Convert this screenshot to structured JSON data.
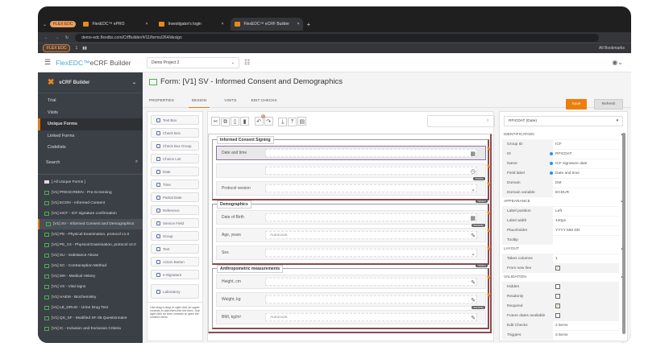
{
  "browser": {
    "profile_badge": "FLEX EDC",
    "tabs": [
      {
        "label": "FlexEDC™ ePRO"
      },
      {
        "label": "Investigator's login"
      },
      {
        "label": "FlexEDC™ eCRF Builder"
      }
    ],
    "url": "demo-edc.flexdbs.com/CrfBuilder/#/11/forms/264/design",
    "bookmark_badge": "FLEX EDC",
    "bookmark_count": "1",
    "all_bookmarks": "All Bookmarks"
  },
  "header": {
    "brand_prefix": "FlexEDC™",
    "brand_suffix": "eCRF Builder",
    "project": "Demo Project 2"
  },
  "sidebar": {
    "title": "eCRF Builder",
    "nav": [
      "Trial",
      "Visits",
      "Unique Forms",
      "Linked Forms",
      "Codelists"
    ],
    "search": "Search",
    "all_forms": "[ All Unique Forms ]",
    "forms": [
      "[V1] PRESCREEN - Pre-Screening",
      "[V1] ECON - Informed Consent",
      "[V1] eICF - ICF signature confirmation",
      "[V1] SV - Informed Consent and Demographics",
      "[V1] PE - Physical Examination, protocol v1.0",
      "[V1] PE_V2 - Physical Examination, protocol v2.0",
      "[V1] SU - Substance Abuse",
      "[V1] SC - Contraception Method",
      "[V1] MH - Medical History",
      "[V1] VS - Vital signs",
      "[V1] HAEM - Biochemistry",
      "[V1] LB_DRUG - Urine Drug Test",
      "[V1] QS_SF - Modified SF-36 Questionnaire",
      "[V1] IC - Inclusion and Exclusion Criteria"
    ]
  },
  "page": {
    "title": "Form: [V1] SV - Informed Consent and Demographics",
    "tabs": [
      "PROPERTIES",
      "DESIGN",
      "VISITS",
      "EDIT CHECKS"
    ],
    "save": "Save",
    "refresh": "Refresh",
    "undo_count": "0"
  },
  "toolbox": {
    "items": [
      "Text Box",
      "Check Box",
      "Check Box Group",
      "Choice List",
      "Date",
      "Time",
      "Partial Date",
      "Reference",
      "Service Field",
      "Group",
      "Text",
      "Action Button",
      "e-Signature",
      "Laboratory"
    ],
    "hint": "Use drag-n-drop or right click on upper controls to add them into the form. Use right click on form controls to open the context menu."
  },
  "form": {
    "groups": [
      {
        "title": "Informed Consent Signing",
        "fields": [
          {
            "label": "Date and time",
            "value": "",
            "icon": "calendar"
          },
          {
            "label": "",
            "value": "",
            "icon": "clock"
          },
          {
            "label": "Protocol version",
            "value": "",
            "icon": "dropdown",
            "tag": "hidden"
          }
        ]
      },
      {
        "title": "Demographics",
        "tag": "hidden",
        "fields": [
          {
            "label": "Date of Birth",
            "value": "",
            "icon": "calendar"
          },
          {
            "label": "Age, years",
            "value": "Autocount",
            "icon": "edit",
            "tag": "readonly"
          },
          {
            "label": "Sex",
            "value": "",
            "icon": "dropdown"
          }
        ]
      },
      {
        "title": "Anthropometric measurements",
        "tag": "hidden",
        "fields": [
          {
            "label": "Height, cm",
            "value": "",
            "icon": "edit"
          },
          {
            "label": "Weight, kg",
            "value": "",
            "icon": "edit"
          },
          {
            "label": "BMI, kg/m²",
            "value": "Autocount",
            "icon": "edit",
            "tag": "readonly"
          }
        ]
      }
    ]
  },
  "props": {
    "selector": "RFICDAT (Date)",
    "identification": {
      "title": "IDENTIFICATION",
      "rows": [
        [
          "Group ID",
          "ICF"
        ],
        [
          "ID",
          "RFICDAT"
        ],
        [
          "Name",
          "ICF signature date"
        ],
        [
          "Field label",
          "Date and time"
        ],
        [
          "Domain",
          "DM"
        ],
        [
          "Domain variable",
          "ECDUR"
        ]
      ]
    },
    "appearance": {
      "title": "APPEARANCE",
      "rows": [
        [
          "Label position",
          "Left"
        ],
        [
          "Label width",
          "140px"
        ],
        [
          "Placeholder",
          "YYYY MM DD"
        ],
        [
          "Tooltip",
          ""
        ]
      ]
    },
    "layout": {
      "title": "LAYOUT",
      "rows": [
        [
          "Takes columns",
          "1"
        ],
        [
          "From new line",
          true
        ]
      ]
    },
    "validation": {
      "title": "VALIDATION",
      "rows": [
        [
          "Hidden",
          false
        ],
        [
          "Readonly",
          false
        ],
        [
          "Required",
          true
        ],
        [
          "Future dates available",
          false
        ],
        [
          "Edit Checks",
          "2 items"
        ],
        [
          "Triggers",
          "3 items"
        ]
      ]
    }
  }
}
